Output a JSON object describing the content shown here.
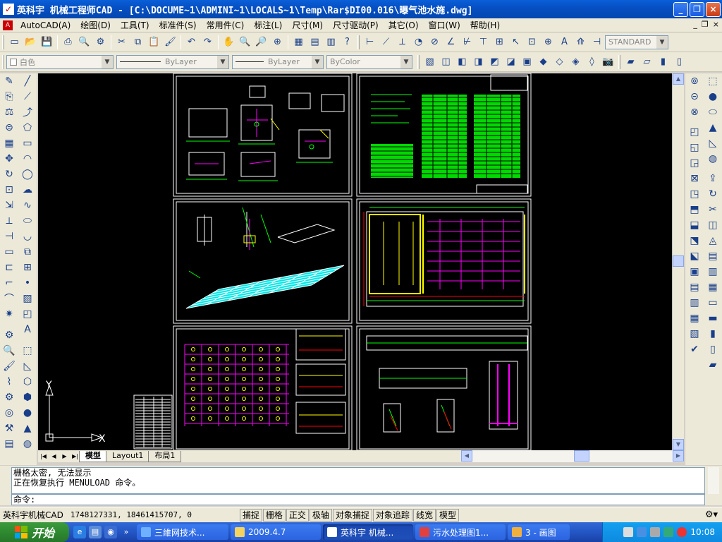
{
  "window": {
    "title": "英科宇 机械工程师CAD - [C:\\DOCUME~1\\ADMINI~1\\LOCALS~1\\Temp\\Rar$DI00.016\\曝气池水施.dwg]",
    "minimize": "_",
    "restore": "❐",
    "close": "×"
  },
  "menu": {
    "items": [
      "AutoCAD(A)",
      "绘图(D)",
      "工具(T)",
      "标准件(S)",
      "常用件(C)",
      "标注(L)",
      "尺寸(M)",
      "尺寸驱动(P)",
      "其它(O)",
      "窗口(W)",
      "帮助(H)"
    ],
    "mdi": [
      "_",
      "❐",
      "×"
    ]
  },
  "toolbar": {
    "style_combo": "STANDARD",
    "layer_combo": "白色",
    "linetype_combo": "ByLayer",
    "lineweight_combo": "ByLayer",
    "color_combo": "ByColor"
  },
  "ucs": {
    "x_label": "X",
    "y_label": "Y"
  },
  "tabs": {
    "items": [
      "模型",
      "Layout1",
      "布局1"
    ],
    "active": "模型"
  },
  "command": {
    "lines": [
      "栅格太密, 无法显示",
      "正在恢复执行 MENULOAD 命令。"
    ],
    "prompt": "命令:"
  },
  "status": {
    "app_name": "英科宇机械CAD",
    "coords": "1748127331, 18461415707, 0",
    "toggles": [
      "捕捉",
      "栅格",
      "正交",
      "极轴",
      "对象捕捉",
      "对象追踪",
      "线宽",
      "模型"
    ]
  },
  "taskbar": {
    "start_label": "开始",
    "tasks": [
      {
        "label": "三維网技术..."
      },
      {
        "label": "2009.4.7"
      },
      {
        "label": "英科宇 机械..."
      },
      {
        "label": "污水处理图1..."
      },
      {
        "label": "3 - 画图"
      }
    ],
    "active_task": "英科宇 机械...",
    "clock": "10:08"
  },
  "colors": {
    "titlebar": "#0650c4",
    "drawing_bg": "#000000",
    "cad_cyan": "#00ffff",
    "cad_magenta": "#ff00ff",
    "cad_yellow": "#ffff00",
    "cad_green": "#00ff00",
    "cad_white": "#ffffff",
    "cad_red": "#ff0000",
    "taskbar": "#2456c5",
    "start": "#2f8a2f"
  }
}
